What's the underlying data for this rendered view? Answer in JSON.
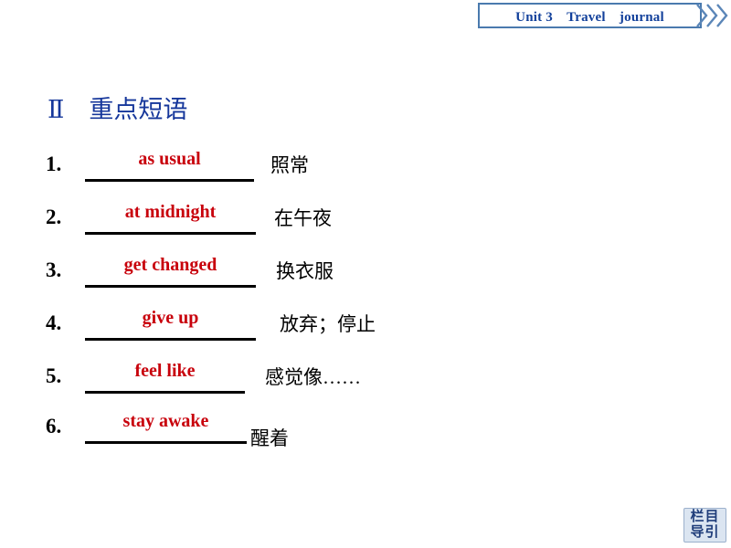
{
  "header": {
    "unit_title": "Unit 3　Travel　journal",
    "chevron_icon": "triple-chevron-right-icon",
    "border_color": "#4a7aae",
    "title_color": "#12409b"
  },
  "section": {
    "heading": "Ⅱ　重点短语",
    "heading_color": "#16379b"
  },
  "colors": {
    "answer_red": "#c8000b",
    "rule_black": "#000000",
    "nav_button_bg": "#dbe5f1",
    "nav_button_text": "#1f3d7a"
  },
  "phrases": [
    {
      "number": "1.",
      "answer": "as usual",
      "meaning": "照常"
    },
    {
      "number": "2.",
      "answer": "at midnight",
      "meaning": "在午夜"
    },
    {
      "number": "3.",
      "answer": "get changed",
      "meaning": "换衣服"
    },
    {
      "number": "4.",
      "answer": "give up",
      "meaning": "放弃；停止"
    },
    {
      "number": "5.",
      "answer": "feel like",
      "meaning": "感觉像……"
    },
    {
      "number": "6.",
      "answer": "stay awake",
      "meaning": "醒着"
    }
  ],
  "nav_button": {
    "line1": "栏目",
    "line2": "导引"
  }
}
